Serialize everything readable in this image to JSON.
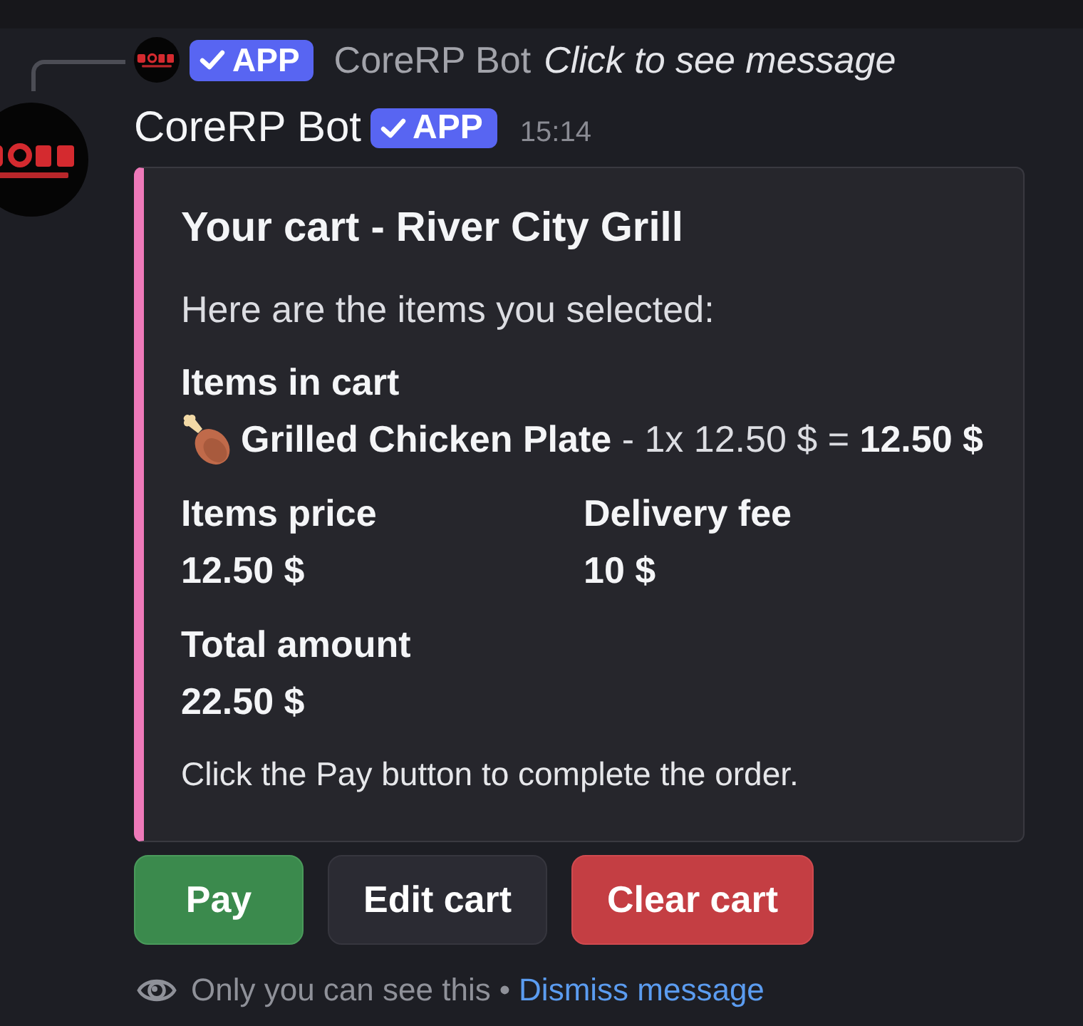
{
  "reply": {
    "author": "CoreRP Bot",
    "badge": {
      "label": "APP",
      "verified": true
    },
    "preview": "Click to see message"
  },
  "message": {
    "author": "CoreRP Bot",
    "badge": {
      "label": "APP",
      "verified": true
    },
    "time": "15:14"
  },
  "embed": {
    "title": "Your cart - River City Grill",
    "description": "Here are the items you selected:",
    "fields": [
      {
        "name": "Items in cart",
        "value": "**Grilled Chicken Plate** - 1x 12.50 $ = **12.50 $**",
        "kind": "cart_line",
        "inline": false
      },
      {
        "name": "Items price",
        "value": "12.50 $",
        "kind": "amount",
        "inline": true
      },
      {
        "name": "Delivery fee",
        "value": "10 $",
        "kind": "amount",
        "inline": true
      },
      {
        "name": "Total amount",
        "value": "22.50 $",
        "kind": "amount",
        "inline": false
      }
    ],
    "footer": "Click the Pay button to complete the order."
  },
  "buttons": [
    {
      "label": "Pay",
      "kind": "success"
    },
    {
      "label": "Edit cart",
      "kind": "secondary"
    },
    {
      "label": "Clear cart",
      "kind": "danger"
    }
  ],
  "notice": {
    "text": "Only you can see this",
    "separator": "•",
    "link": "Dismiss message"
  }
}
